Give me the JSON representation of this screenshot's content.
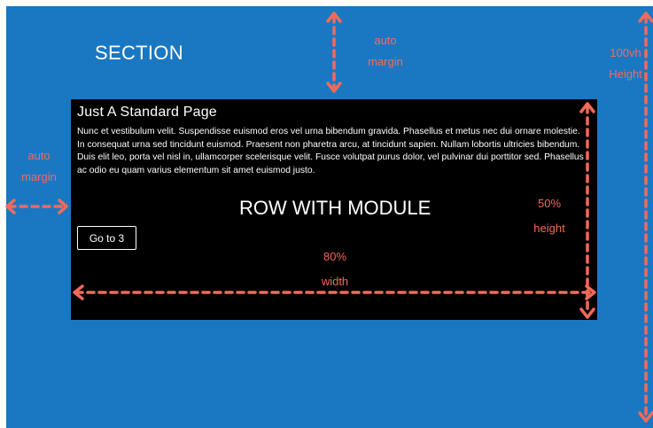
{
  "section": {
    "label": "SECTION"
  },
  "annotations": {
    "top_margin": {
      "line1": "auto",
      "line2": "margin"
    },
    "left_margin": {
      "line1": "auto",
      "line2": "margin"
    },
    "section_height": {
      "line1": "100vh",
      "line2": "Height"
    },
    "row_height": {
      "line1": "50%",
      "line2": "height"
    },
    "row_width": {
      "line1": "80%",
      "line2": "width"
    }
  },
  "row": {
    "label": "ROW WITH MODULE"
  },
  "module": {
    "title": "Just A Standard Page",
    "body": "Nunc et vestibulum velit. Suspendisse euismod eros vel urna bibendum gravida. Phasellus et metus nec dui ornare molestie. In consequat urna sed tincidunt euismod. Praesent non pharetra arcu, at tincidunt sapien. Nullam lobortis ultricies bibendum. Duis elit leo, porta vel nisl in, ullamcorper scelerisque velit. Fusce volutpat purus dolor, vel pulvinar dui porttitor sed. Phasellus ac odio eu quam varius elementum sit amet euismod justo.",
    "button_label": "Go to 3"
  },
  "colors": {
    "section_background": "#1a78c2",
    "row_background": "#000000",
    "annotation": "#f26a5a",
    "text": "#ffffff"
  }
}
